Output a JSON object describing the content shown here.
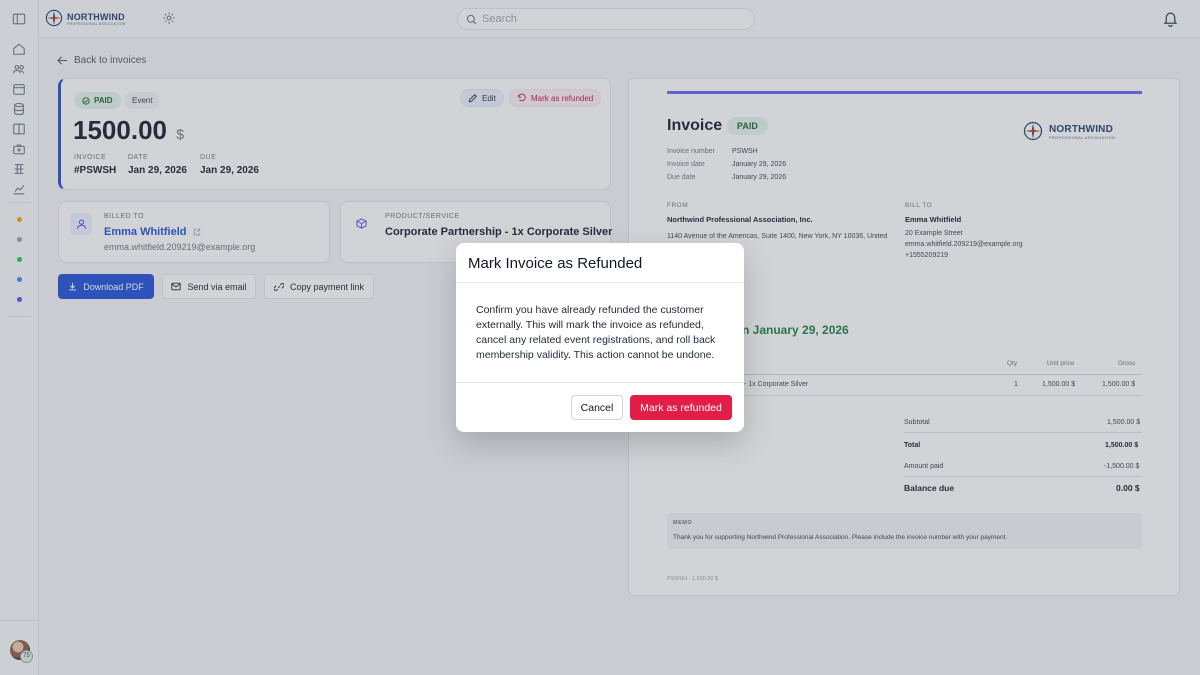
{
  "app": {
    "brand": "NORTHWIND",
    "brand_subtitle": "PROFESSIONAL ASSOCIATION",
    "search_placeholder": "Search",
    "avatar_badge": "75"
  },
  "sidebar": {
    "icons": [
      "sidebar-toggle-icon",
      "home-icon",
      "users-icon",
      "calendar-icon",
      "database-icon",
      "book-icon",
      "briefcase-icon",
      "network-icon",
      "chart-icon"
    ],
    "dot_colors": [
      "#f59e0b",
      "#9ca3af",
      "#22c55e",
      "#3b82f6",
      "#7c3aed"
    ]
  },
  "page": {
    "back_label": "Back to invoices"
  },
  "summary": {
    "status": "PAID",
    "tag": "Event",
    "amount": "1500.00",
    "currency": "$",
    "edit_label": "Edit",
    "refund_label": "Mark as refunded",
    "invoice_label": "INVOICE",
    "invoice_value": "#PSWSH",
    "date_label": "DATE",
    "date_value": "Jan 29, 2026",
    "due_label": "DUE",
    "due_value": "Jan 29, 2026"
  },
  "billed": {
    "label": "BILLED TO",
    "name": "Emma Whitfield",
    "email": "emma.whitfield.209219@example.org"
  },
  "product": {
    "label": "PRODUCT/SERVICE",
    "name": "Corporate Partnership - 1x Corporate Silver"
  },
  "actions": {
    "download": "Download PDF",
    "email": "Send via email",
    "copy": "Copy payment link"
  },
  "document": {
    "title": "Invoice",
    "status": "PAID",
    "meta": [
      {
        "k": "Invoice number",
        "v": "PSWSH"
      },
      {
        "k": "Invoice date",
        "v": "January 29, 2026"
      },
      {
        "k": "Due date",
        "v": "January 29, 2026"
      }
    ],
    "from_label": "FROM",
    "from_name": "Northwind Professional Association, Inc.",
    "from_address": "1140 Avenue of the Americas, Suite 1400, New York, NY 10036, United",
    "bill_label": "BILL TO",
    "bill_name": "Emma Whitfield",
    "bill_street": "20 Example Street",
    "bill_email": "emma.whitfield.209219@example.org",
    "bill_phone": "+1555209219",
    "paid_banner_partial": "d on January 29, 2026",
    "col_qty": "Qty",
    "col_unit": "Unit price",
    "col_gross": "Gross",
    "line_desc_partial": "- 1x Corporate Silver",
    "line_qty": "1",
    "line_unit": "1,500.00 $",
    "line_gross": "1,500.00 $",
    "subtotal_label": "Subtotal",
    "subtotal_value": "1,500.00 $",
    "total_label": "Total",
    "total_value": "1,500.00 $",
    "amount_paid_label": "Amount paid",
    "amount_paid_value": "-1,500.00 $",
    "balance_label": "Balance due",
    "balance_value": "0.00 $",
    "memo_label": "MEMO",
    "memo_text": "Thank you for supporting Northwind Professional Association. Please include the invoice number with your payment.",
    "footer": "PSWSH · 1,500.00 $",
    "accent_color": "#6366f1"
  },
  "modal": {
    "title": "Mark Invoice as Refunded",
    "body": "Confirm you have already refunded the customer externally. This will mark the invoice as refunded, cancel any related event registrations, and roll back membership validity. This action cannot be undone.",
    "cancel": "Cancel",
    "confirm": "Mark as refunded",
    "confirm_color": "#e11d48"
  }
}
